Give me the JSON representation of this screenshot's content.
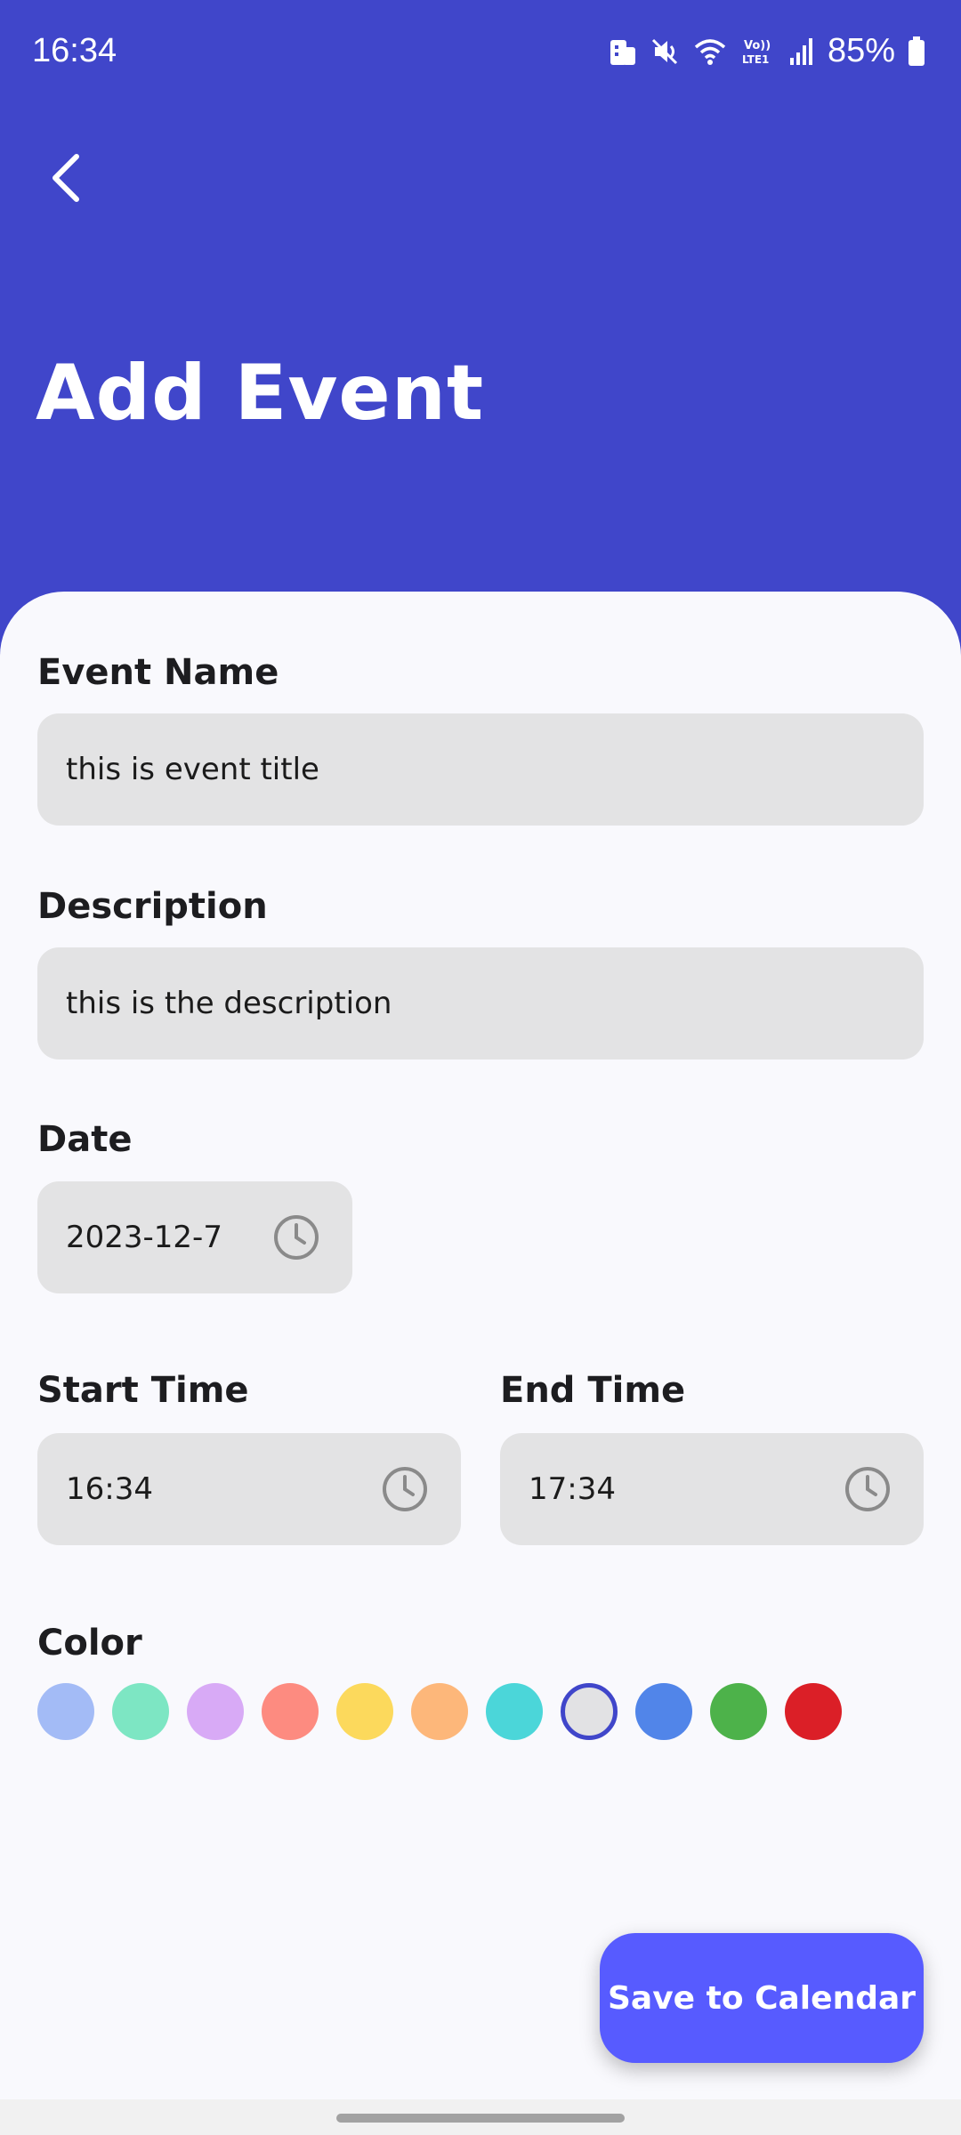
{
  "status_bar": {
    "time": "16:34",
    "battery": "85%",
    "icons": [
      "app-notification-icon",
      "mute-icon",
      "wifi-icon",
      "volte-icon",
      "signal-icon",
      "battery-icon"
    ]
  },
  "header": {
    "back_icon": "chevron-left-icon",
    "title": "Add Event",
    "background_color": "#4046ca"
  },
  "form": {
    "event_name": {
      "label": "Event Name",
      "value": "this is event title"
    },
    "description": {
      "label": "Description",
      "value": "this is the description"
    },
    "date": {
      "label": "Date",
      "value": "2023-12-7",
      "icon": "clock-icon"
    },
    "start_time": {
      "label": "Start Time",
      "value": "16:34",
      "icon": "clock-icon"
    },
    "end_time": {
      "label": "End Time",
      "value": "17:34",
      "icon": "clock-icon"
    },
    "color": {
      "label": "Color",
      "options": [
        "#a3bbf6",
        "#7de6c3",
        "#d8aaf6",
        "#fd8b80",
        "#fcd95c",
        "#fdb77a",
        "#4bd6d9",
        "#e2e2e4",
        "#5185e9",
        "#4db24a",
        "#db1f27"
      ],
      "selected_index": 7
    }
  },
  "actions": {
    "save_label": "Save to Calendar",
    "save_color": "#575bff"
  }
}
